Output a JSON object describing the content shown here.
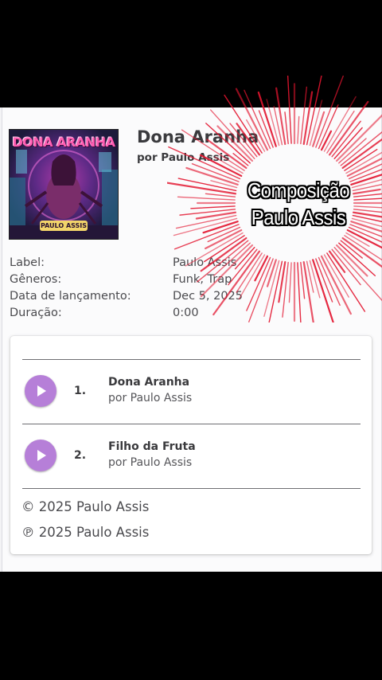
{
  "album": {
    "cover_title": "DONA ARANHA",
    "cover_artist": "PAULO ASSIS",
    "title": "Dona Aranha",
    "by": "por Paulo Assis"
  },
  "meta": [
    {
      "label": "Label:",
      "value": "Paulo Assis"
    },
    {
      "label": "Gêneros:",
      "value": "Funk, Trap"
    },
    {
      "label": "Data de lançamento:",
      "value": "Dec 5, 2025"
    },
    {
      "label": "Duração:",
      "value": "0:00"
    }
  ],
  "tracks": [
    {
      "number": "1.",
      "title": "Dona Aranha",
      "artist": "por Paulo Assis"
    },
    {
      "number": "2.",
      "title": "Filho da Fruta",
      "artist": "por Paulo Assis"
    }
  ],
  "copyright": {
    "c_line": "© 2025 Paulo Assis",
    "p_line": "℗ 2025 Paulo Assis"
  },
  "overlay": {
    "line1": "Composição",
    "line2": "Paulo Assis",
    "burst_color": "#e3152f"
  },
  "colors": {
    "play_button": "#b67fd8",
    "text": "#3a3a3d"
  }
}
